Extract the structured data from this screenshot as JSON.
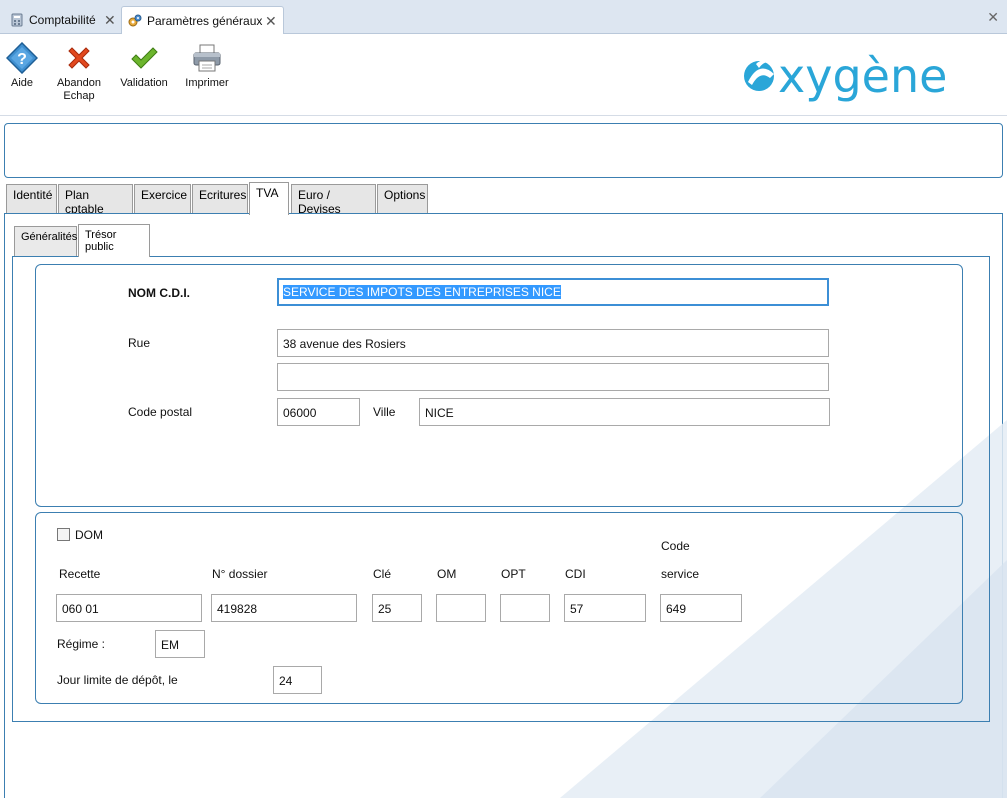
{
  "window_tabs": [
    {
      "label": "Comptabilité",
      "icon": "calculator-icon"
    },
    {
      "label": "Paramètres généraux",
      "icon": "gears-icon"
    }
  ],
  "toolbar": {
    "aide": "Aide",
    "abandon_line1": "Abandon",
    "abandon_line2": "Echap",
    "validation": "Validation",
    "imprimer": "Imprimer"
  },
  "brand": {
    "logo_text": "oxygène",
    "color": "#2aa6d8"
  },
  "main_tabs": [
    "Identité",
    "Plan cptable",
    "Exercice",
    "Ecritures",
    "TVA",
    "Euro / Devises",
    "Options"
  ],
  "active_main_tab": "TVA",
  "sub_tabs": [
    "Généralités",
    "Trésor public"
  ],
  "active_sub_tab": "Trésor public",
  "tresor": {
    "nom_cdi_label": "NOM C.D.I.",
    "nom_cdi_value": "SERVICE DES IMPOTS DES ENTREPRISES NICE",
    "rue_label": "Rue",
    "rue_value": "38 avenue  des Rosiers",
    "rue2_value": "",
    "code_postal_label": "Code postal",
    "code_postal_value": "06000",
    "ville_label": "Ville",
    "ville_value": "NICE"
  },
  "codes": {
    "dom_label": "DOM",
    "dom_checked": false,
    "recette_label": "Recette",
    "recette_value": "060 01",
    "dossier_label": "N° dossier",
    "dossier_value": "419828",
    "cle_label": "Clé",
    "cle_value": "25",
    "om_label": "OM",
    "om_value": "",
    "opt_label": "OPT",
    "opt_value": "",
    "cdi_label": "CDI",
    "cdi_value": "57",
    "code_service_label1": "Code",
    "code_service_label2": "service",
    "code_service_value": "649",
    "regime_label": "Régime :",
    "regime_value": "EM",
    "jour_label": "Jour limite de dépôt, le",
    "jour_value": "24"
  },
  "colors": {
    "accent": "#3c7fb1",
    "selection": "#3399ff",
    "tab_bar": "#dde6f1"
  }
}
